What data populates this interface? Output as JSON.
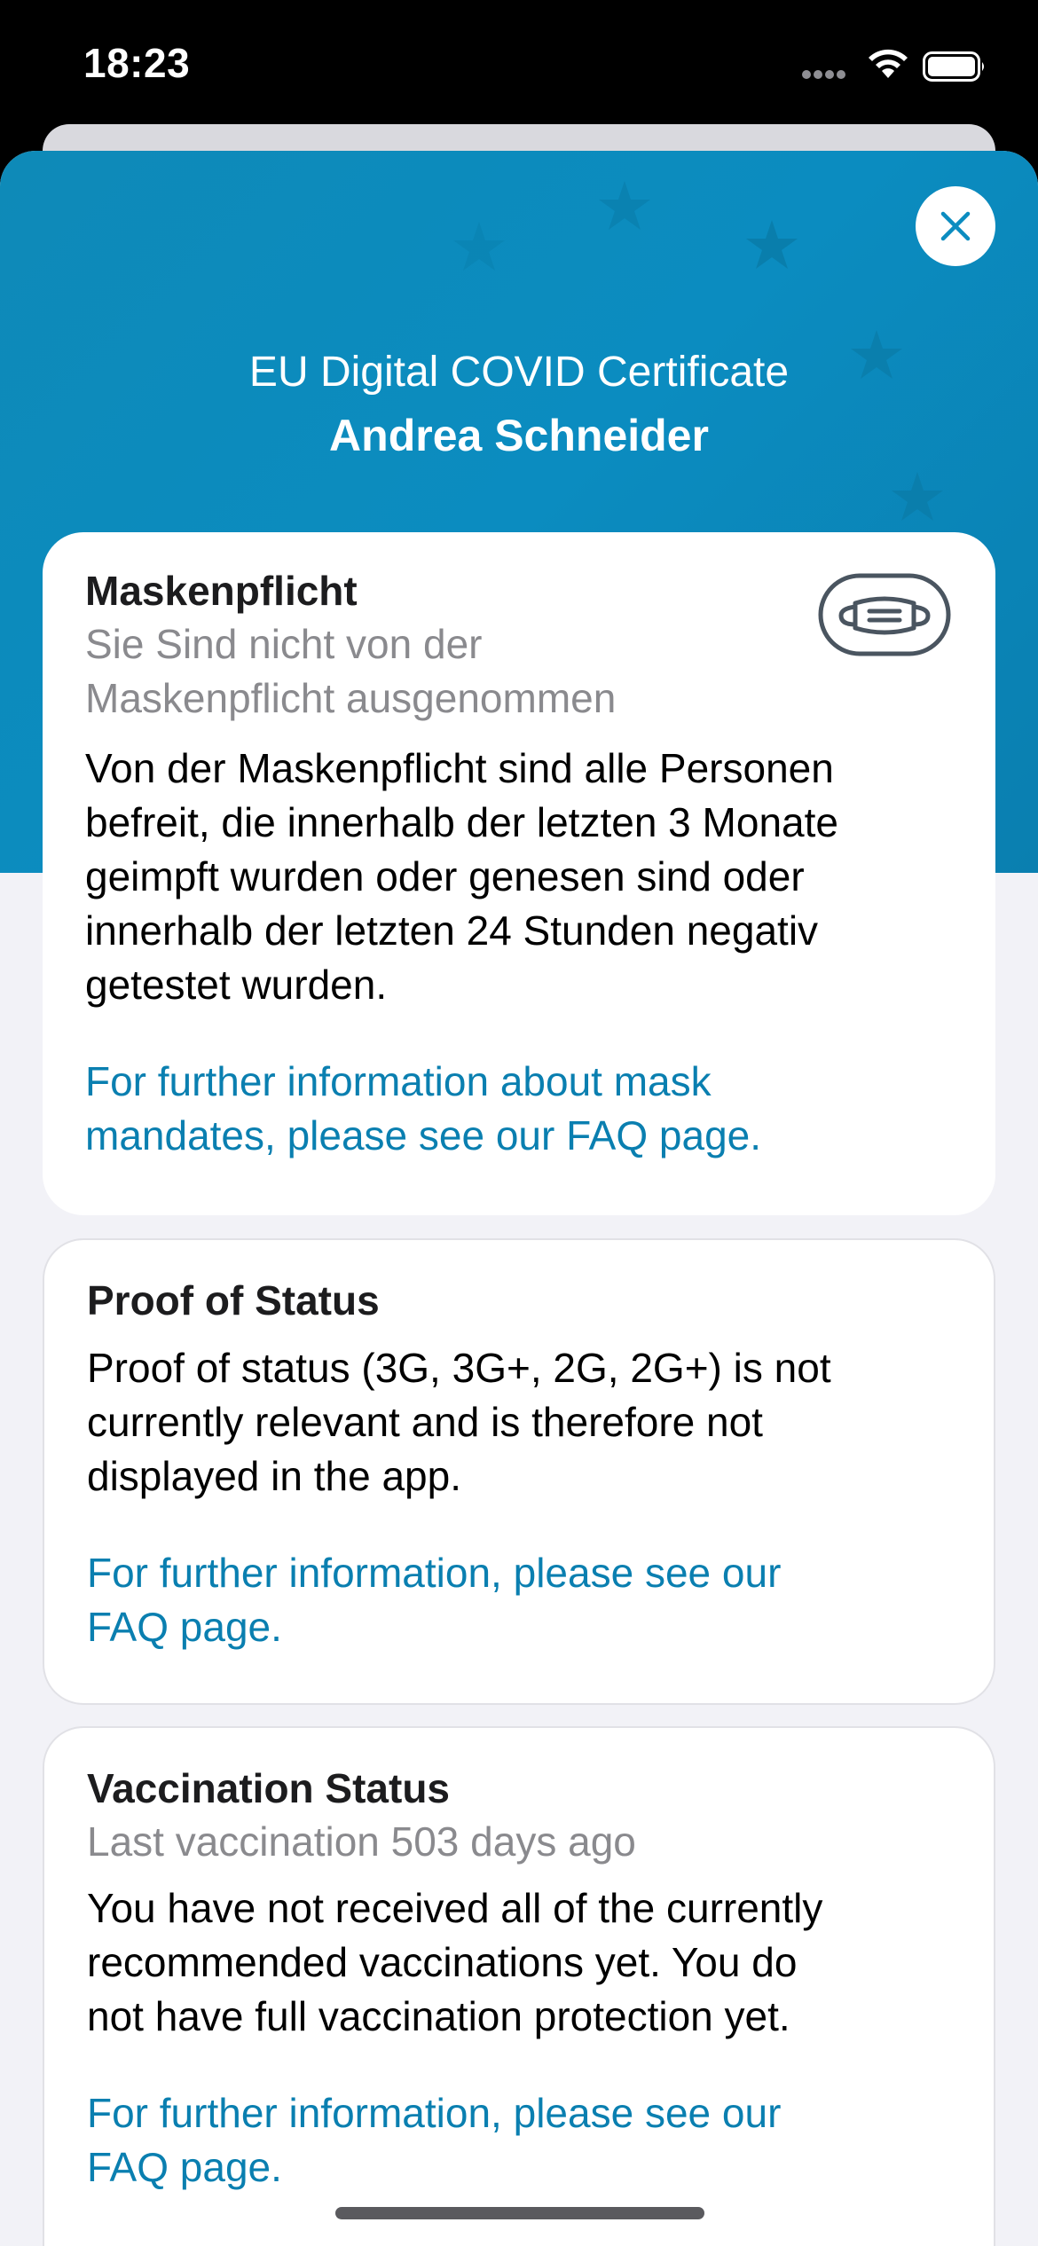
{
  "status_bar": {
    "time": "18:23"
  },
  "header": {
    "title": "EU Digital COVID Certificate",
    "name": "Andrea Schneider",
    "accent_color": "#0b8cc0"
  },
  "icons": {
    "close": "close-icon",
    "mask": "mask-icon",
    "wifi": "wifi-icon",
    "battery": "battery-icon"
  },
  "cards": {
    "mask": {
      "title": "Maskenpflicht",
      "subtitle_line1": "Sie Sind nicht von der",
      "subtitle_line2": "Maskenpflicht ausgenommen",
      "body_line1": "Von der Maskenpflicht sind alle Personen",
      "body_line2": "befreit, die innerhalb der letzten 3 Monate",
      "body_line3": "geimpft wurden oder genesen sind oder",
      "body_line4": "innerhalb der letzten 24 Stunden negativ",
      "body_line5": "getestet wurden.",
      "link_line1": "For further information about mask",
      "link_line2": "mandates, please see our FAQ page."
    },
    "proof": {
      "title": "Proof of Status",
      "body_line1": "Proof of status (3G, 3G+, 2G, 2G+) is not",
      "body_line2": "currently relevant and is therefore not",
      "body_line3": "displayed in the app.",
      "link_line1": "For further information, please see our",
      "link_line2": "FAQ page."
    },
    "vaccination": {
      "title": "Vaccination Status",
      "subtitle": "Last vaccination 503 days ago",
      "body_line1": "You have not received all of the currently",
      "body_line2": "recommended vaccinations yet. You do",
      "body_line3": "not have full vaccination protection yet.",
      "link_line1": "For further information, please see our",
      "link_line2": "FAQ page."
    }
  }
}
